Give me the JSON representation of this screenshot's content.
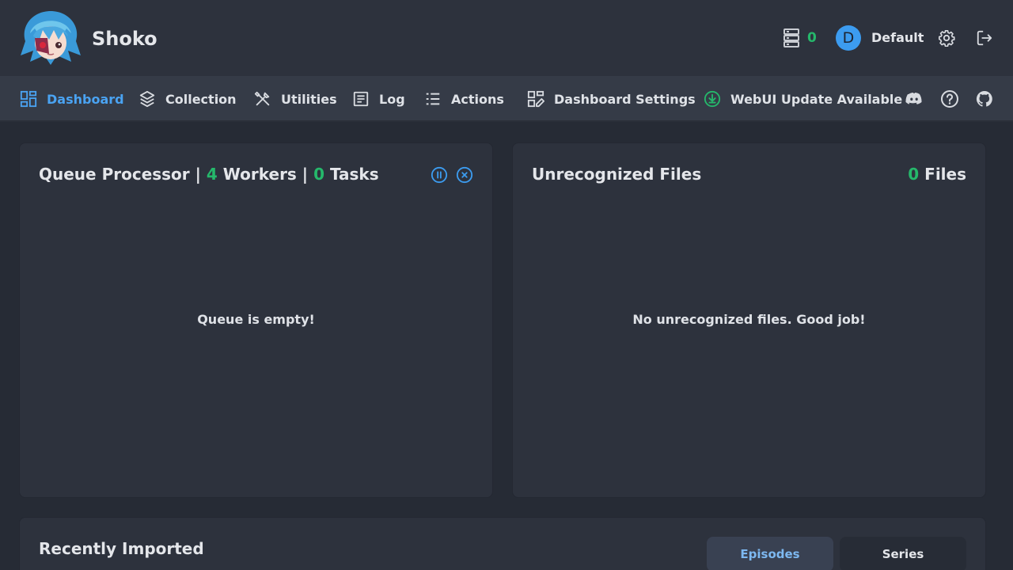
{
  "header": {
    "brand": "Shoko",
    "queue_count": "0",
    "user_initial": "D",
    "username": "Default",
    "icons": [
      "queue-server-icon",
      "gear-icon",
      "logout-icon"
    ]
  },
  "nav": {
    "items": [
      {
        "label": "Dashboard",
        "icon": "dashboard-icon",
        "active": true
      },
      {
        "label": "Collection",
        "icon": "layers-icon",
        "active": false
      },
      {
        "label": "Utilities",
        "icon": "tools-icon",
        "active": false
      },
      {
        "label": "Log",
        "icon": "log-icon",
        "active": false
      },
      {
        "label": "Actions",
        "icon": "list-icon",
        "active": false
      },
      {
        "label": "Dashboard Settings",
        "icon": "dashboard-edit-icon",
        "active": false
      },
      {
        "label": "WebUI Update Available",
        "icon": "download-circle-icon",
        "active": false
      }
    ],
    "external_icons": [
      "discord-icon",
      "help-icon",
      "github-icon"
    ]
  },
  "queue_panel": {
    "title_prefix": "Queue Processor | ",
    "workers_count": "4",
    "workers_label": " Workers | ",
    "tasks_count": "0",
    "tasks_label": " Tasks",
    "empty_text": "Queue is empty!"
  },
  "unrecognized_panel": {
    "title": "Unrecognized Files",
    "count": "0",
    "count_label": " Files",
    "empty_text": "No unrecognized files. Good job!"
  },
  "recent_panel": {
    "title": "Recently Imported",
    "tabs": [
      {
        "label": "Episodes",
        "active": true
      },
      {
        "label": "Series",
        "active": false
      }
    ]
  },
  "colors": {
    "accent": "#4aa3f2",
    "success": "#25b86b",
    "background": "#262b35",
    "panel": "#2d323d",
    "navbar": "#353b47"
  }
}
